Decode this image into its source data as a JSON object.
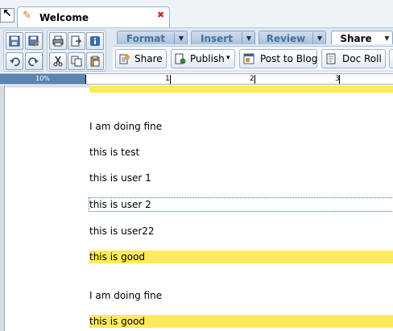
{
  "tab": {
    "title": "Welcome",
    "close_glyph": "✖"
  },
  "toolbar": {
    "icons": [
      "save-icon",
      "save-as-icon",
      "print-icon",
      "export-icon",
      "info-icon",
      "undo-icon",
      "redo-icon",
      "cut-icon",
      "copy-icon",
      "paste-icon"
    ]
  },
  "ribbon": {
    "tabs": [
      {
        "label": "Format"
      },
      {
        "label": "Insert"
      },
      {
        "label": "Review"
      },
      {
        "label": "Share"
      }
    ],
    "buttons": [
      {
        "label": "Share",
        "icon": "share-icon"
      },
      {
        "label": "Publish",
        "icon": "publish-icon",
        "dropdown": "▾"
      },
      {
        "label": "Post to Blog",
        "icon": "blog-icon"
      },
      {
        "label": "Doc Roll",
        "icon": "docroll-icon"
      }
    ]
  },
  "ruler": {
    "zoom": "10%",
    "marks": [
      "1",
      "2",
      "3"
    ]
  },
  "document": {
    "paragraphs": [
      {
        "text": "I am doing fine",
        "highlight": false
      },
      {
        "text": "this is test",
        "highlight": false
      },
      {
        "text": "this is user 1",
        "highlight": false
      },
      {
        "text": "this is user 2",
        "highlight": false,
        "focused": true
      },
      {
        "text": "this is user22",
        "highlight": false
      },
      {
        "text": "this is good",
        "highlight": true
      },
      {
        "text": "I am doing fine",
        "highlight": false
      },
      {
        "text": "this is good",
        "highlight": true
      }
    ]
  },
  "colors": {
    "highlight": "#ffea5c",
    "accent": "#5b84b3",
    "tab_text": "#4a6f9c"
  }
}
